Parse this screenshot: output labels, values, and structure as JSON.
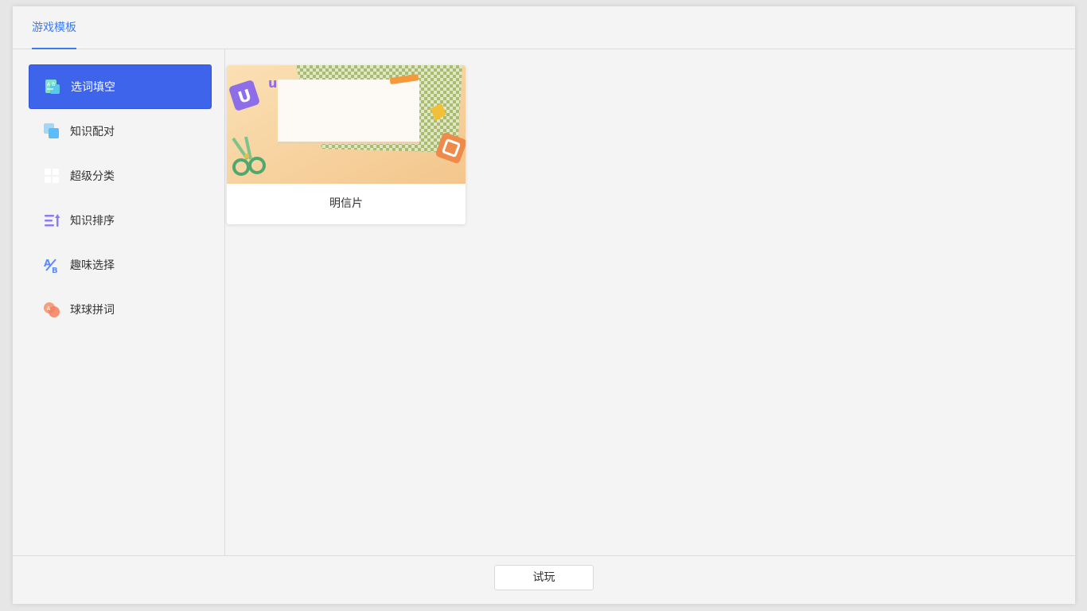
{
  "header": {
    "tab_label": "游戏模板",
    "accent_color": "#3d7bf0"
  },
  "sidebar": {
    "active_color": "#3d64eb",
    "items": [
      {
        "label": "选词填空",
        "icon": "fill-blank-icon",
        "active": true
      },
      {
        "label": "知识配对",
        "icon": "matching-icon",
        "active": false
      },
      {
        "label": "超级分类",
        "icon": "grid-classify-icon",
        "active": false
      },
      {
        "label": "知识排序",
        "icon": "sort-list-icon",
        "active": false
      },
      {
        "label": "趣味选择",
        "icon": "ab-choice-icon",
        "active": false
      },
      {
        "label": "球球拼词",
        "icon": "bubble-spell-icon",
        "active": false
      }
    ]
  },
  "content": {
    "templates": [
      {
        "title": "明信片",
        "thumbnail": "postcard-thumbnail"
      }
    ]
  },
  "footer": {
    "try_button_label": "试玩"
  }
}
